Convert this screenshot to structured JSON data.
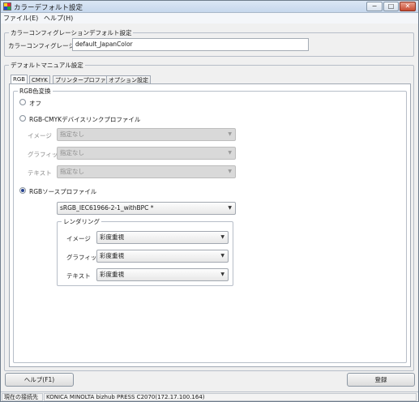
{
  "window": {
    "title": "カラーデフォルト設定"
  },
  "window_controls": {
    "minimize": "−",
    "maximize": "□",
    "close": "✕"
  },
  "menu": {
    "file": "ファイル(E)",
    "help": "ヘルプ(H)"
  },
  "color_config_group": {
    "legend": "カラーコンフィグレーションデフォルト設定",
    "label": "カラーコンフィグレーション",
    "value": "default_JapanColor"
  },
  "manual_group": {
    "legend": "デフォルトマニュアル設定"
  },
  "tabs": [
    "RGB",
    "CMYK",
    "プリンタープロファイル",
    "オプション設定"
  ],
  "rgb_panel": {
    "legend": "RGB色変換",
    "radio_off": "オフ",
    "radio_devicelink": "RGB-CMYKデバイスリンクプロファイル",
    "devicelink_rows": [
      {
        "label": "イメージ",
        "value": "指定なし"
      },
      {
        "label": "グラフィック",
        "value": "指定なし"
      },
      {
        "label": "テキスト",
        "value": "指定なし"
      }
    ],
    "radio_source": "RGBソースプロファイル",
    "source_profile": "sRGB_IEC61966-2-1_withBPC *",
    "rendering": {
      "legend": "レンダリング",
      "rows": [
        {
          "label": "イメージ",
          "value": "彩度重視"
        },
        {
          "label": "グラフィック",
          "value": "彩度重視"
        },
        {
          "label": "テキスト",
          "value": "彩度重視"
        }
      ]
    },
    "selected": "source"
  },
  "buttons": {
    "help": "ヘルプ(F1)",
    "register": "登録"
  },
  "status": {
    "label": "現在の接続先",
    "connection": "KONICA MINOLTA bizhub PRESS C2070(172.17.100.164)"
  },
  "icons": {
    "combo_arrow": "▼"
  }
}
